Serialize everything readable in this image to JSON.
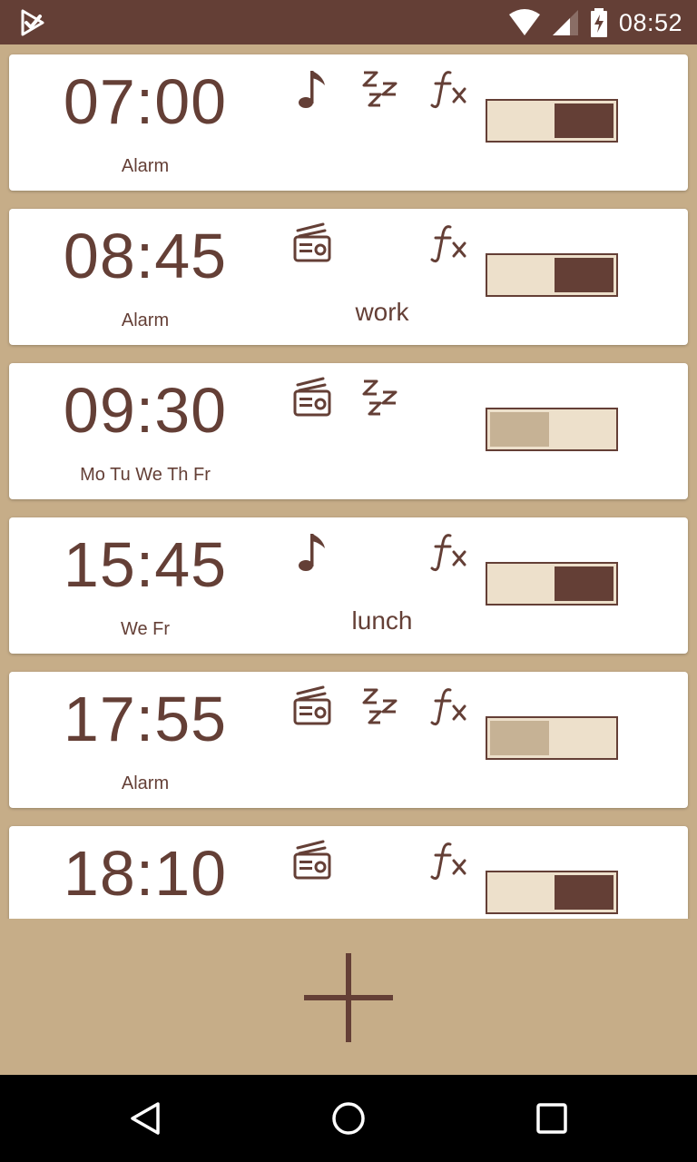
{
  "status_bar": {
    "time": "08:52",
    "icons": [
      "play-store-notification-icon",
      "wifi-icon",
      "cell-signal-icon",
      "battery-charging-icon"
    ]
  },
  "alarms": [
    {
      "time": "07:00",
      "days": "Alarm",
      "sound": "music-note-icon",
      "snooze": true,
      "fx": true,
      "label": "",
      "enabled": true
    },
    {
      "time": "08:45",
      "days": "Alarm",
      "sound": "radio-icon",
      "snooze": false,
      "fx": true,
      "label": "work",
      "enabled": true
    },
    {
      "time": "09:30",
      "days": "Mo Tu We Th Fr",
      "sound": "radio-icon",
      "snooze": true,
      "fx": false,
      "label": "",
      "enabled": false
    },
    {
      "time": "15:45",
      "days": "We Fr",
      "sound": "music-note-icon",
      "snooze": false,
      "fx": true,
      "label": "lunch",
      "enabled": true
    },
    {
      "time": "17:55",
      "days": "Alarm",
      "sound": "radio-icon",
      "snooze": true,
      "fx": true,
      "label": "",
      "enabled": false
    },
    {
      "time": "18:10",
      "days": "",
      "sound": "radio-icon",
      "snooze": false,
      "fx": true,
      "label": "",
      "enabled": true
    }
  ],
  "add_button": {
    "icon": "plus-icon"
  },
  "nav_bar": {
    "buttons": [
      "back-icon",
      "home-icon",
      "recents-icon"
    ]
  },
  "colors": {
    "primary": "#643f36",
    "background": "#c6ad88",
    "card": "#ffffff",
    "toggle_track": "#ede0cb",
    "toggle_off_thumb": "#c6b295"
  }
}
